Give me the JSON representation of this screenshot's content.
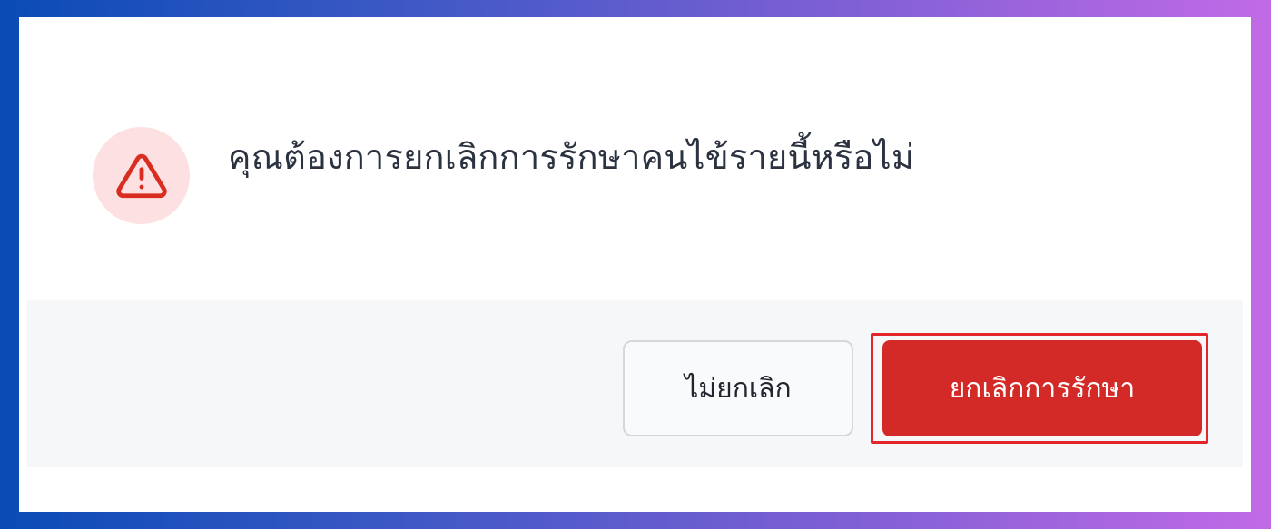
{
  "dialog": {
    "message": "คุณต้องการยกเลิกการรักษาคนไข้รายนี้หรือไม่",
    "icon": "warning-triangle-icon",
    "cancel_label": "ไม่ยกเลิก",
    "confirm_label": "ยกเลิกการรักษา"
  },
  "colors": {
    "accent_danger": "#d42a27",
    "icon_bg": "#fde0e1",
    "icon_color": "#d92d20",
    "footer_bg": "#f6f7f9",
    "focus_ring": "#e3262d"
  }
}
